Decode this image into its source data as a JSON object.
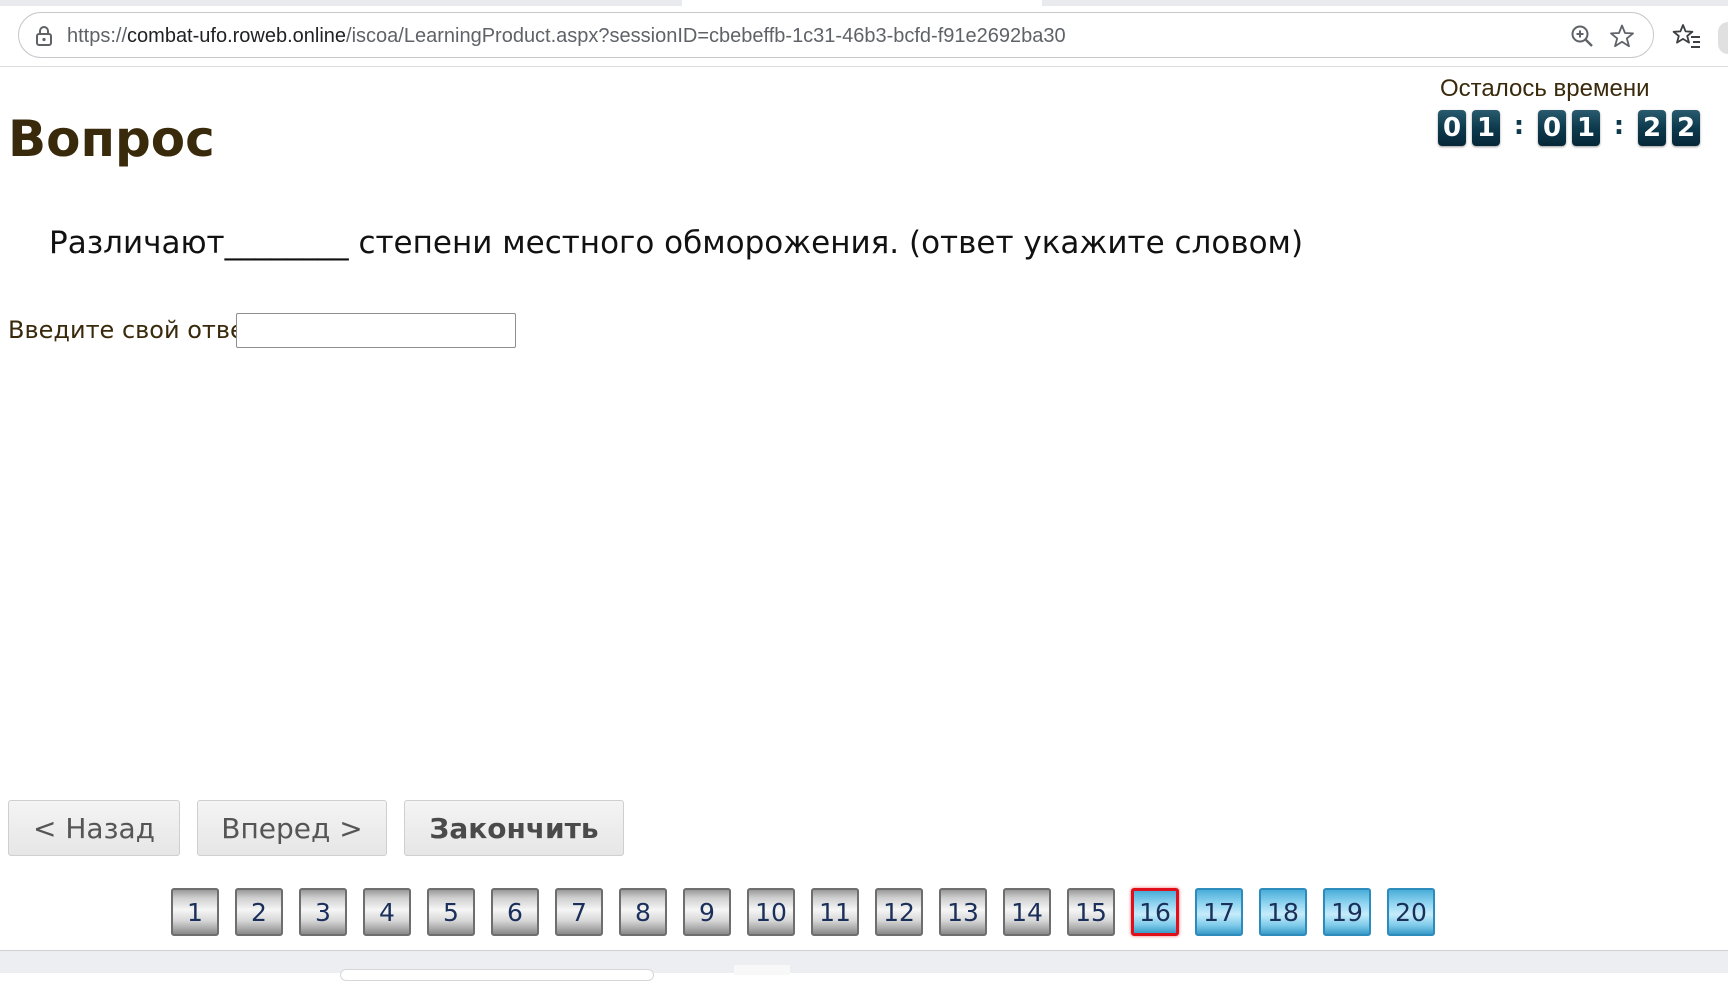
{
  "browser": {
    "url_prefix": "https://",
    "url_host": "combat-ufo.roweb.online",
    "url_path": "/iscoa/LearningProduct.aspx?sessionID=cbebeffb-1c31-46b3-bcfd-f91e2692ba30",
    "icons": [
      "lock-icon",
      "zoom-icon",
      "star-icon",
      "favorites-list-icon"
    ]
  },
  "timer": {
    "label": "Осталось времени",
    "digits": [
      "0",
      "1",
      ":",
      "0",
      "1",
      ":",
      "2",
      "2"
    ]
  },
  "question": {
    "title": "Вопрос",
    "text": "Различают________ степени местного обморожения. (ответ укажите словом)",
    "answer_label": "Введите свой ответ",
    "answer_value": ""
  },
  "navigation": {
    "back_label": "< Назад",
    "next_label": "Вперед >",
    "finish_label": "Закончить"
  },
  "question_nav": {
    "current": 16,
    "items": [
      {
        "label": "1",
        "state": "done"
      },
      {
        "label": "2",
        "state": "done"
      },
      {
        "label": "3",
        "state": "done"
      },
      {
        "label": "4",
        "state": "done"
      },
      {
        "label": "5",
        "state": "done"
      },
      {
        "label": "6",
        "state": "done"
      },
      {
        "label": "7",
        "state": "done"
      },
      {
        "label": "8",
        "state": "done"
      },
      {
        "label": "9",
        "state": "done"
      },
      {
        "label": "10",
        "state": "done"
      },
      {
        "label": "11",
        "state": "done"
      },
      {
        "label": "12",
        "state": "done"
      },
      {
        "label": "13",
        "state": "done"
      },
      {
        "label": "14",
        "state": "done"
      },
      {
        "label": "15",
        "state": "done"
      },
      {
        "label": "16",
        "state": "current"
      },
      {
        "label": "17",
        "state": "todo"
      },
      {
        "label": "18",
        "state": "todo"
      },
      {
        "label": "19",
        "state": "todo"
      },
      {
        "label": "20",
        "state": "todo"
      }
    ]
  },
  "colors": {
    "heading": "#3a2a0c",
    "timer_digit_bg": "#0d3a4d",
    "current_border": "#e0101a",
    "todo_blue": "#8fd4f0",
    "done_gray": "#d6d6d6"
  }
}
